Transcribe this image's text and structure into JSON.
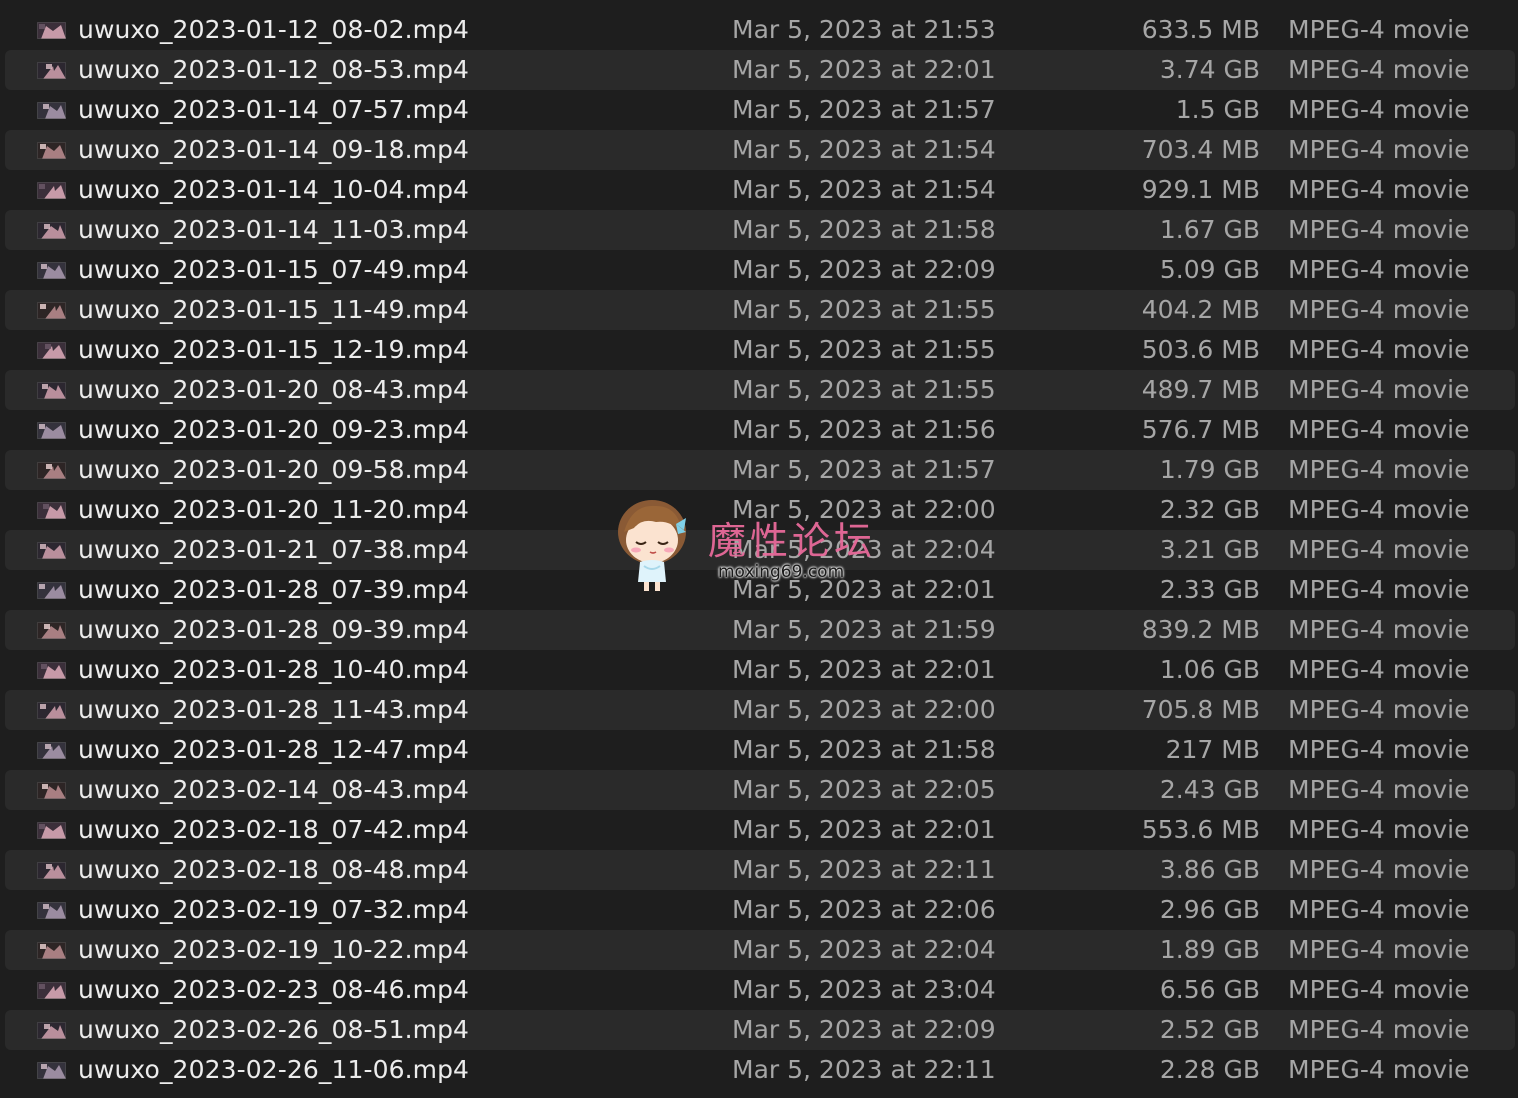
{
  "files": [
    {
      "name": "uwuxo_2023-01-12_08-02.mp4",
      "date": "Mar 5, 2023 at 21:53",
      "size": "633.5 MB",
      "kind": "MPEG-4 movie"
    },
    {
      "name": "uwuxo_2023-01-12_08-53.mp4",
      "date": "Mar 5, 2023 at 22:01",
      "size": "3.74 GB",
      "kind": "MPEG-4 movie"
    },
    {
      "name": "uwuxo_2023-01-14_07-57.mp4",
      "date": "Mar 5, 2023 at 21:57",
      "size": "1.5 GB",
      "kind": "MPEG-4 movie"
    },
    {
      "name": "uwuxo_2023-01-14_09-18.mp4",
      "date": "Mar 5, 2023 at 21:54",
      "size": "703.4 MB",
      "kind": "MPEG-4 movie"
    },
    {
      "name": "uwuxo_2023-01-14_10-04.mp4",
      "date": "Mar 5, 2023 at 21:54",
      "size": "929.1 MB",
      "kind": "MPEG-4 movie"
    },
    {
      "name": "uwuxo_2023-01-14_11-03.mp4",
      "date": "Mar 5, 2023 at 21:58",
      "size": "1.67 GB",
      "kind": "MPEG-4 movie"
    },
    {
      "name": "uwuxo_2023-01-15_07-49.mp4",
      "date": "Mar 5, 2023 at 22:09",
      "size": "5.09 GB",
      "kind": "MPEG-4 movie"
    },
    {
      "name": "uwuxo_2023-01-15_11-49.mp4",
      "date": "Mar 5, 2023 at 21:55",
      "size": "404.2 MB",
      "kind": "MPEG-4 movie"
    },
    {
      "name": "uwuxo_2023-01-15_12-19.mp4",
      "date": "Mar 5, 2023 at 21:55",
      "size": "503.6 MB",
      "kind": "MPEG-4 movie"
    },
    {
      "name": "uwuxo_2023-01-20_08-43.mp4",
      "date": "Mar 5, 2023 at 21:55",
      "size": "489.7 MB",
      "kind": "MPEG-4 movie"
    },
    {
      "name": "uwuxo_2023-01-20_09-23.mp4",
      "date": "Mar 5, 2023 at 21:56",
      "size": "576.7 MB",
      "kind": "MPEG-4 movie"
    },
    {
      "name": "uwuxo_2023-01-20_09-58.mp4",
      "date": "Mar 5, 2023 at 21:57",
      "size": "1.79 GB",
      "kind": "MPEG-4 movie"
    },
    {
      "name": "uwuxo_2023-01-20_11-20.mp4",
      "date": "Mar 5, 2023 at 22:00",
      "size": "2.32 GB",
      "kind": "MPEG-4 movie"
    },
    {
      "name": "uwuxo_2023-01-21_07-38.mp4",
      "date": "Mar 5, 2023 at 22:04",
      "size": "3.21 GB",
      "kind": "MPEG-4 movie"
    },
    {
      "name": "uwuxo_2023-01-28_07-39.mp4",
      "date": "Mar 5, 2023 at 22:01",
      "size": "2.33 GB",
      "kind": "MPEG-4 movie"
    },
    {
      "name": "uwuxo_2023-01-28_09-39.mp4",
      "date": "Mar 5, 2023 at 21:59",
      "size": "839.2 MB",
      "kind": "MPEG-4 movie"
    },
    {
      "name": "uwuxo_2023-01-28_10-40.mp4",
      "date": "Mar 5, 2023 at 22:01",
      "size": "1.06 GB",
      "kind": "MPEG-4 movie"
    },
    {
      "name": "uwuxo_2023-01-28_11-43.mp4",
      "date": "Mar 5, 2023 at 22:00",
      "size": "705.8 MB",
      "kind": "MPEG-4 movie"
    },
    {
      "name": "uwuxo_2023-01-28_12-47.mp4",
      "date": "Mar 5, 2023 at 21:58",
      "size": "217 MB",
      "kind": "MPEG-4 movie"
    },
    {
      "name": "uwuxo_2023-02-14_08-43.mp4",
      "date": "Mar 5, 2023 at 22:05",
      "size": "2.43 GB",
      "kind": "MPEG-4 movie"
    },
    {
      "name": "uwuxo_2023-02-18_07-42.mp4",
      "date": "Mar 5, 2023 at 22:01",
      "size": "553.6 MB",
      "kind": "MPEG-4 movie"
    },
    {
      "name": "uwuxo_2023-02-18_08-48.mp4",
      "date": "Mar 5, 2023 at 22:11",
      "size": "3.86 GB",
      "kind": "MPEG-4 movie"
    },
    {
      "name": "uwuxo_2023-02-19_07-32.mp4",
      "date": "Mar 5, 2023 at 22:06",
      "size": "2.96 GB",
      "kind": "MPEG-4 movie"
    },
    {
      "name": "uwuxo_2023-02-19_10-22.mp4",
      "date": "Mar 5, 2023 at 22:04",
      "size": "1.89 GB",
      "kind": "MPEG-4 movie"
    },
    {
      "name": "uwuxo_2023-02-23_08-46.mp4",
      "date": "Mar 5, 2023 at 23:04",
      "size": "6.56 GB",
      "kind": "MPEG-4 movie"
    },
    {
      "name": "uwuxo_2023-02-26_08-51.mp4",
      "date": "Mar 5, 2023 at 22:09",
      "size": "2.52 GB",
      "kind": "MPEG-4 movie"
    },
    {
      "name": "uwuxo_2023-02-26_11-06.mp4",
      "date": "Mar 5, 2023 at 22:11",
      "size": "2.28 GB",
      "kind": "MPEG-4 movie"
    }
  ],
  "watermark": {
    "title": "魔性论坛",
    "url": "moxing69.com"
  },
  "colors": {
    "background": "#1e1e1e",
    "row_alt": "#2a2a2a",
    "name_text": "#ececec",
    "meta_text": "#a6a6a6",
    "watermark_pink": "#e86a9a"
  },
  "icons": {
    "file_thumbnail": "video-thumbnail-icon",
    "watermark_mascot": "mascot-girl-icon"
  }
}
